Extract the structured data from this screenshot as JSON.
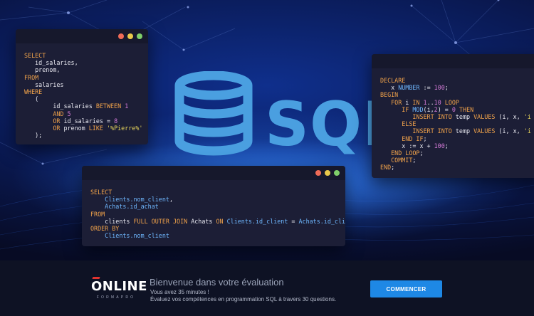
{
  "colors": {
    "hero_bg": "#0f2f8c",
    "window_bg": "#1c1e36",
    "keyword": "#f0a24a",
    "identifier": "#6fb8ff",
    "string": "#e6d35a",
    "number": "#d27ad6",
    "button": "#1e88e5",
    "brand_accent": "#e0332f"
  },
  "logo": {
    "text": "SQL",
    "icon": "database-icon"
  },
  "windows": [
    {
      "lines": [
        [
          [
            "kw",
            "SELECT"
          ]
        ],
        [
          [
            "tx",
            "   id_salaries,"
          ]
        ],
        [
          [
            "tx",
            "   prenom,"
          ]
        ],
        [
          [
            "kw",
            "FROM"
          ]
        ],
        [
          [
            "tx",
            "   salaries"
          ]
        ],
        [
          [
            "kw",
            "WHERE"
          ]
        ],
        [
          [
            "tx",
            "   ("
          ]
        ],
        [
          [
            "tx",
            "        id_salaries "
          ],
          [
            "kw",
            "BETWEEN "
          ],
          [
            "nm",
            "1"
          ]
        ],
        [
          [
            "kw",
            "        AND "
          ],
          [
            "nm",
            "5"
          ]
        ],
        [
          [
            "kw",
            "        OR "
          ],
          [
            "tx",
            "id_salaries = "
          ],
          [
            "nm",
            "8"
          ]
        ],
        [
          [
            "kw",
            "        OR "
          ],
          [
            "tx",
            "prenom "
          ],
          [
            "kw",
            "LIKE "
          ],
          [
            "st",
            "'%Pierre%'"
          ]
        ],
        [
          [
            "tx",
            "   );"
          ]
        ]
      ]
    },
    {
      "lines": [
        [
          [
            "kw",
            "DECLARE"
          ]
        ],
        [
          [
            "tx",
            "   x "
          ],
          [
            "id",
            "NUMBER"
          ],
          [
            "tx",
            " := "
          ],
          [
            "nm",
            "100"
          ],
          [
            "tx",
            ";"
          ]
        ],
        [
          [
            "kw",
            "BEGIN"
          ]
        ],
        [
          [
            "kw",
            "   FOR "
          ],
          [
            "tx",
            "i "
          ],
          [
            "kw",
            "IN "
          ],
          [
            "nm",
            "1"
          ],
          [
            "tx",
            ".."
          ],
          [
            "nm",
            "10"
          ],
          [
            "kw",
            " LOOP"
          ]
        ],
        [
          [
            "kw",
            "      IF "
          ],
          [
            "id",
            "MOD"
          ],
          [
            "tx",
            "(i,"
          ],
          [
            "nm",
            "2"
          ],
          [
            "tx",
            ") = "
          ],
          [
            "nm",
            "0"
          ],
          [
            "kw",
            " THEN"
          ]
        ],
        [
          [
            "kw",
            "         INSERT INTO "
          ],
          [
            "tx",
            "temp "
          ],
          [
            "kw",
            "VALUES "
          ],
          [
            "tx",
            "(i, x, "
          ],
          [
            "st",
            "'i est"
          ]
        ],
        [
          [
            "kw",
            "      ELSE"
          ]
        ],
        [
          [
            "kw",
            "         INSERT INTO "
          ],
          [
            "tx",
            "temp "
          ],
          [
            "kw",
            "VALUES "
          ],
          [
            "tx",
            "(i, x, "
          ],
          [
            "st",
            "'i est"
          ]
        ],
        [
          [
            "kw",
            "      END IF"
          ],
          [
            "tx",
            ";"
          ]
        ],
        [
          [
            "tx",
            "      x := x + "
          ],
          [
            "nm",
            "100"
          ],
          [
            "tx",
            ";"
          ]
        ],
        [
          [
            "kw",
            "   END LOOP"
          ],
          [
            "tx",
            ";"
          ]
        ],
        [
          [
            "kw",
            "   COMMIT"
          ],
          [
            "tx",
            ";"
          ]
        ],
        [
          [
            "kw",
            "END"
          ],
          [
            "tx",
            ";"
          ]
        ]
      ]
    },
    {
      "lines": [
        [
          [
            "kw",
            "SELECT"
          ]
        ],
        [
          [
            "id",
            "    Clients.nom_client"
          ],
          [
            "tx",
            ","
          ]
        ],
        [
          [
            "id",
            "    Achats.id_achat"
          ]
        ],
        [
          [
            "kw",
            "FROM"
          ]
        ],
        [
          [
            "tx",
            "    clients "
          ],
          [
            "kw",
            "FULL OUTER JOIN "
          ],
          [
            "tx",
            "Achats "
          ],
          [
            "kw",
            "ON "
          ],
          [
            "id",
            "Clients.id_client"
          ],
          [
            "tx",
            " = "
          ],
          [
            "id",
            "Achats.id_client"
          ]
        ],
        [
          [
            "kw",
            "ORDER BY"
          ]
        ],
        [
          [
            "id",
            "    Clients.nom_client"
          ]
        ]
      ]
    }
  ],
  "banner": {
    "brand_name": "ONLINE",
    "brand_sub": "FORMAPRO",
    "title": "Bienvenue dans votre évaluation",
    "line1": "Vous avez 35 minutes !",
    "line2": "Évaluez vos compétences en programmation SQL à travers 30 questions.",
    "button_label": "COMMENCER"
  }
}
